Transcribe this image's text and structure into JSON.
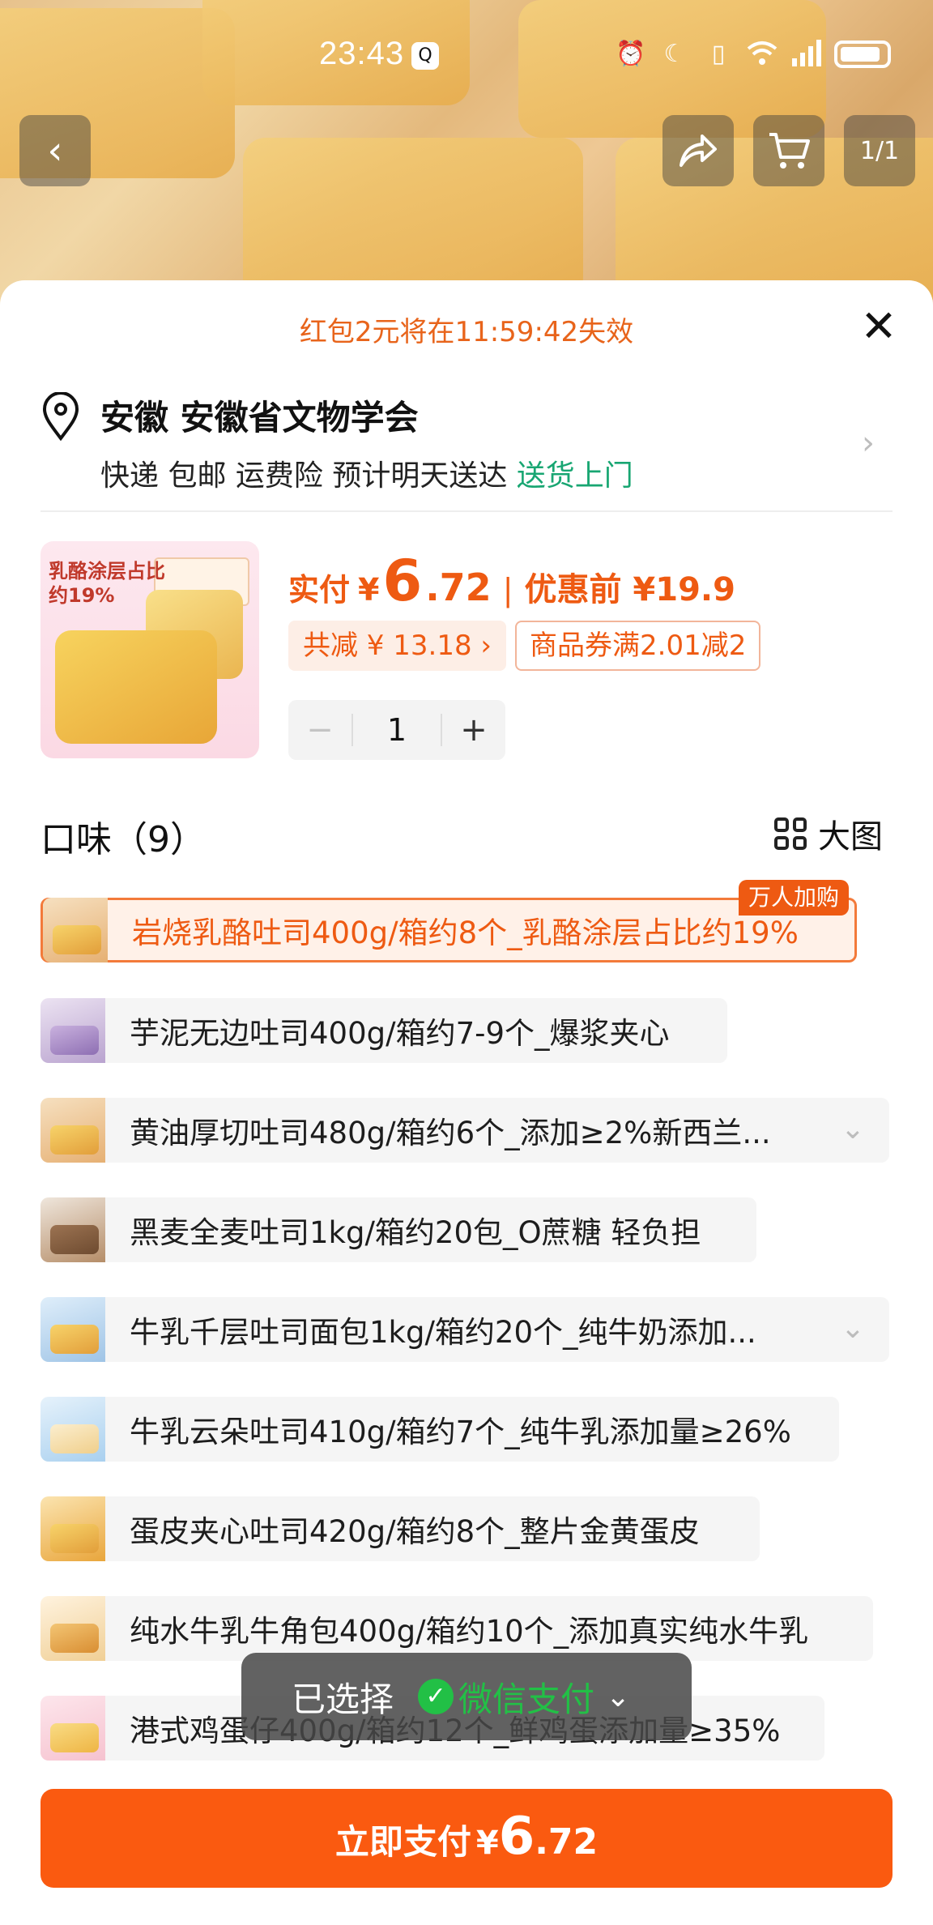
{
  "status_bar": {
    "time": "23:43",
    "qq_icon_char": "Q"
  },
  "top_nav": {
    "back_icon": "chevron-left-icon",
    "share_icon": "share-icon",
    "cart_icon": "cart-icon",
    "more_icon": "more-icon",
    "image_counter": "1/1"
  },
  "banner": {
    "text": "红包2元将在11:59:42失效"
  },
  "address": {
    "title": "安徽 安徽省文物学会",
    "delivery": "快递 包邮 运费险 预计明天送达",
    "delivery_highlight": "送货上门"
  },
  "product": {
    "thumb_label_line1": "乳酪涂层占比",
    "thumb_label_line2": "约19%",
    "pay_label": "实付",
    "currency": "¥",
    "price_int": "6",
    "price_dec": ".72",
    "separator": "|",
    "orig_label": "优惠前 ¥19.9",
    "discount_tag": "共减 ¥ 13.18 ›",
    "coupon_tag": "商品券满2.01减2",
    "quantity": "1",
    "minus": "−",
    "plus": "+"
  },
  "flavor": {
    "title": "口味（9）",
    "big_view_label": "大图",
    "hot_badge": "万人加购",
    "options": [
      {
        "label": "岩烧乳酪吐司400g/箱约8个_乳酪涂层占比约19%",
        "selected": true
      },
      {
        "label": "芋泥无边吐司400g/箱约7-9个_爆浆夹心",
        "selected": false
      },
      {
        "label": "黄油厚切吐司480g/箱约6个_添加≥2%新西兰...",
        "selected": false
      },
      {
        "label": "黑麦全麦吐司1kg/箱约20包_O蔗糖 轻负担",
        "selected": false
      },
      {
        "label": "牛乳千层吐司面包1kg/箱约20个_纯牛奶添加...",
        "selected": false
      },
      {
        "label": "牛乳云朵吐司410g/箱约7个_纯牛乳添加量≥26%",
        "selected": false
      },
      {
        "label": "蛋皮夹心吐司420g/箱约8个_整片金黄蛋皮",
        "selected": false
      },
      {
        "label": "纯水牛乳牛角包400g/箱约10个_添加真实纯水牛乳",
        "selected": false
      },
      {
        "label": "港式鸡蛋仔400g/箱约12个_鲜鸡蛋添加量≥35%",
        "selected": false
      }
    ]
  },
  "toast": {
    "selected_label": "已选择",
    "payment_method": "微信支付",
    "check_glyph": "✓",
    "expand_glyph": "⌄"
  },
  "pay_button": {
    "label": "立即支付",
    "currency": "¥",
    "price_int": "6",
    "price_dec": ".72"
  },
  "colors": {
    "accent": "#ee5a12",
    "pay_button": "#fa5a10",
    "wechat_green": "#22c046",
    "delivery_green": "#18a672"
  }
}
